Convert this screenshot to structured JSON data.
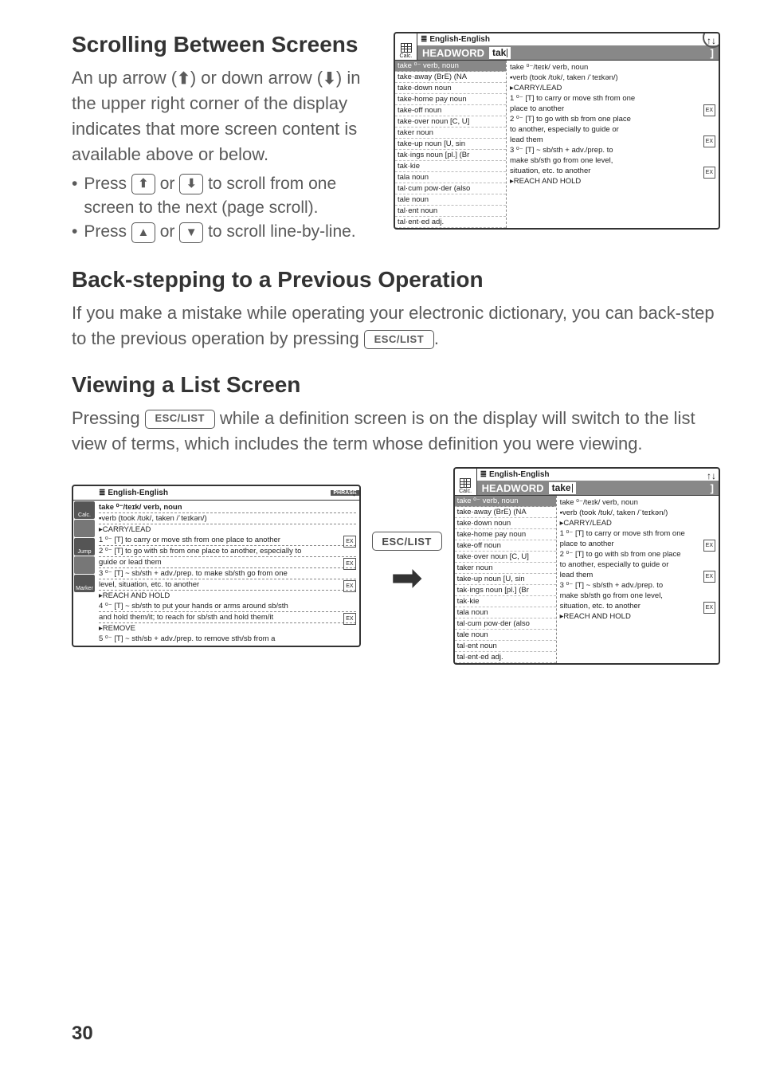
{
  "section1": {
    "heading": "Scrolling Between Screens",
    "intro_pre": "An up arrow (",
    "intro_mid": ") or down arrow (",
    "intro_post": ") in the upper right corner of the display indicates that more screen content is available above or below.",
    "bullet1_a": "Press ",
    "bullet1_b": " or ",
    "bullet1_c": " to scroll from one screen to the next (page scroll).",
    "bullet2_a": "Press ",
    "bullet2_b": " or ",
    "bullet2_c": " to scroll line-by-line."
  },
  "section2": {
    "heading": "Back-stepping to a Previous Operation",
    "p_a": "If you make a mistake while operating your electronic dictionary, you can back-step to the previous operation by pressing ",
    "p_b": "."
  },
  "keys": {
    "esc_list": "ESC/LIST"
  },
  "section3": {
    "heading": "Viewing a List Screen",
    "p_a": "Pressing ",
    "p_b": " while a definition screen is on the display will switch to the list view of terms, which includes the term whose definition you were viewing."
  },
  "screens": {
    "dict_label": "English-English",
    "calc_label": "Calc.",
    "headword_label": "HEADWORD",
    "search_tak": "tak",
    "search_take": "take",
    "updown_indicator": "↑↓",
    "ex_label": "EX",
    "phrase_label": "PHRASE",
    "left_entries": [
      {
        "t": "take ⁰⁻ verb, noun",
        "sel": true
      },
      {
        "t": "take·away (BrE) (NA"
      },
      {
        "t": "take·down noun"
      },
      {
        "t": "take-home pay noun"
      },
      {
        "t": "take-off noun"
      },
      {
        "t": "take·over noun [C, U]"
      },
      {
        "t": "taker noun"
      },
      {
        "t": "take-up noun [U, sin"
      },
      {
        "t": "tak·ings noun [pl.] (Br"
      },
      {
        "t": "tak·kie"
      },
      {
        "t": "tala noun"
      },
      {
        "t": "tal·cum pow·der (also"
      },
      {
        "t": "tale noun"
      },
      {
        "t": "tal·ent noun"
      },
      {
        "t": "tal·ent·ed adj."
      }
    ],
    "right_def": {
      "l1": "take ⁰⁻/teɪk/ verb, noun",
      "l2": "▪verb (took /tʊk/, taken /ˈteɪkən/)",
      "l3": "▸CARRY/LEAD",
      "l4": "1 ⁰⁻ [T] to carry or move sth from one",
      "l5": "   place to another",
      "l6": "2 ⁰⁻ [T] to go with sb from one place",
      "l7": "   to another, especially to guide or",
      "l8": "   lead them",
      "l9": "3 ⁰⁻ [T] ~ sb/sth + adv./prep. to",
      "l10": "   make sb/sth go from one level,",
      "l11": "   situation, etc. to another",
      "l12": "▸REACH AND HOLD"
    },
    "def_full": {
      "l1": "take ⁰⁻/teɪk/ verb, noun",
      "l2": "▪verb (took /tʊk/, taken /ˈteɪkən/)",
      "l3": "▸CARRY/LEAD",
      "l4": "1 ⁰⁻ [T] to carry or move sth from one place to another",
      "l5": "2 ⁰⁻ [T] to go with sb from one place to another, especially to",
      "l6": "   guide or lead them",
      "l7": "3 ⁰⁻ [T] ~ sb/sth + adv./prep. to make sb/sth go from one",
      "l8": "   level, situation, etc. to another",
      "l9": "▸REACH AND HOLD",
      "l10": "4 ⁰⁻ [T] ~ sb/sth to put your hands or arms around sb/sth",
      "l11": "   and hold them/it; to reach for sb/sth and hold them/it",
      "l12": "▸REMOVE",
      "l13": "5 ⁰⁻ [T] ~ sth/sb + adv./prep. to remove sth/sb from a"
    },
    "sideicons": [
      "Calc.",
      "",
      "Jump",
      "",
      "Marker"
    ]
  },
  "page_number": "30"
}
